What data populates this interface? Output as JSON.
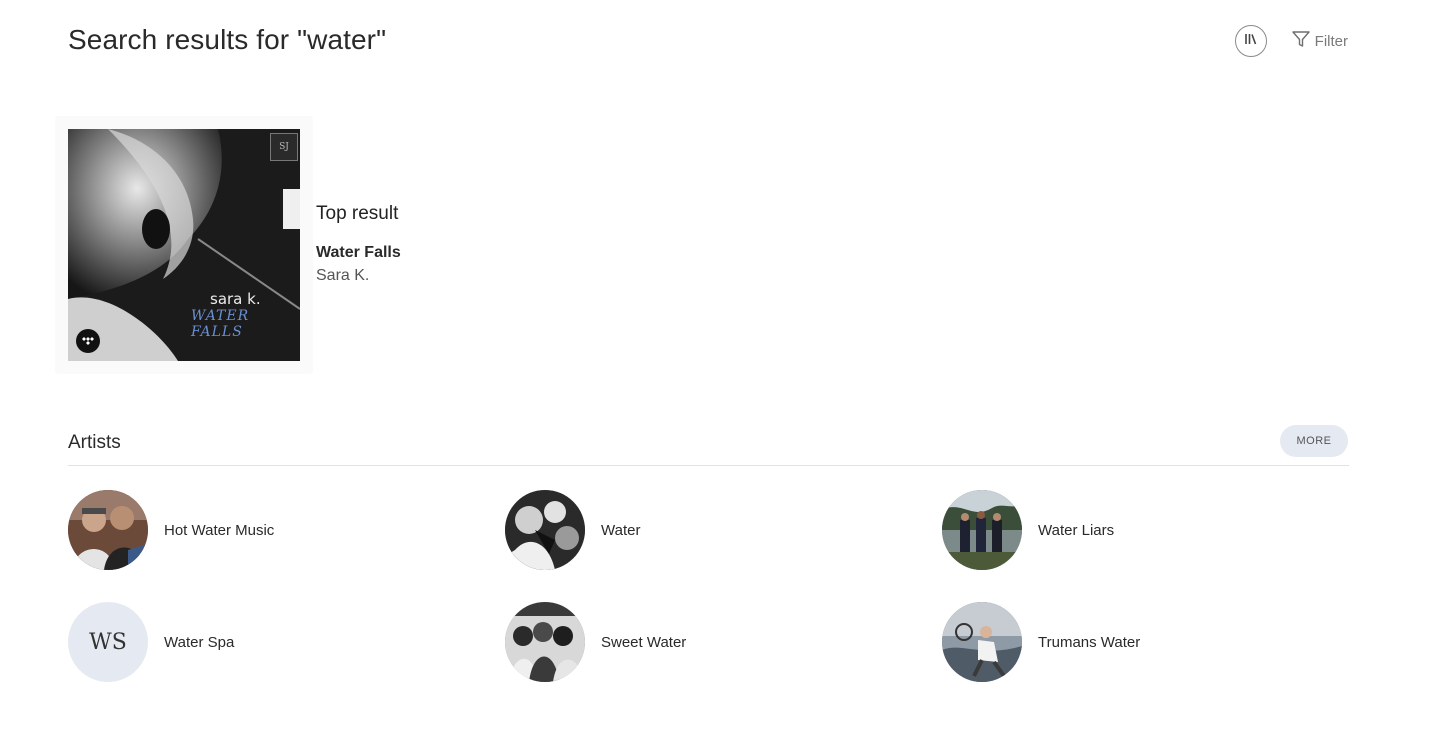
{
  "header": {
    "title": "Search results for \"water\"",
    "filter_label": "Filter",
    "icons": {
      "library": "library-icon",
      "filter": "filter-icon"
    }
  },
  "top_result": {
    "heading": "Top result",
    "title": "Water Falls",
    "subtitle": "Sara K.",
    "cover": {
      "artist_text": "sara k.",
      "album_text": "WATER FALLS",
      "label_logo_text": "SJ",
      "source_icon": "tidal-icon"
    }
  },
  "artists": {
    "heading": "Artists",
    "more_label": "MORE",
    "items": [
      {
        "name": "Hot Water Music"
      },
      {
        "name": "Water"
      },
      {
        "name": "Water Liars"
      },
      {
        "name": "Water Spa",
        "initials": "WS"
      },
      {
        "name": "Sweet Water"
      },
      {
        "name": "Trumans Water"
      }
    ]
  },
  "colors": {
    "accent_pill": "#e5e9f2",
    "text_primary": "#2a2a2a",
    "text_secondary": "#555555",
    "album_title_blue": "#6a8fd1"
  }
}
